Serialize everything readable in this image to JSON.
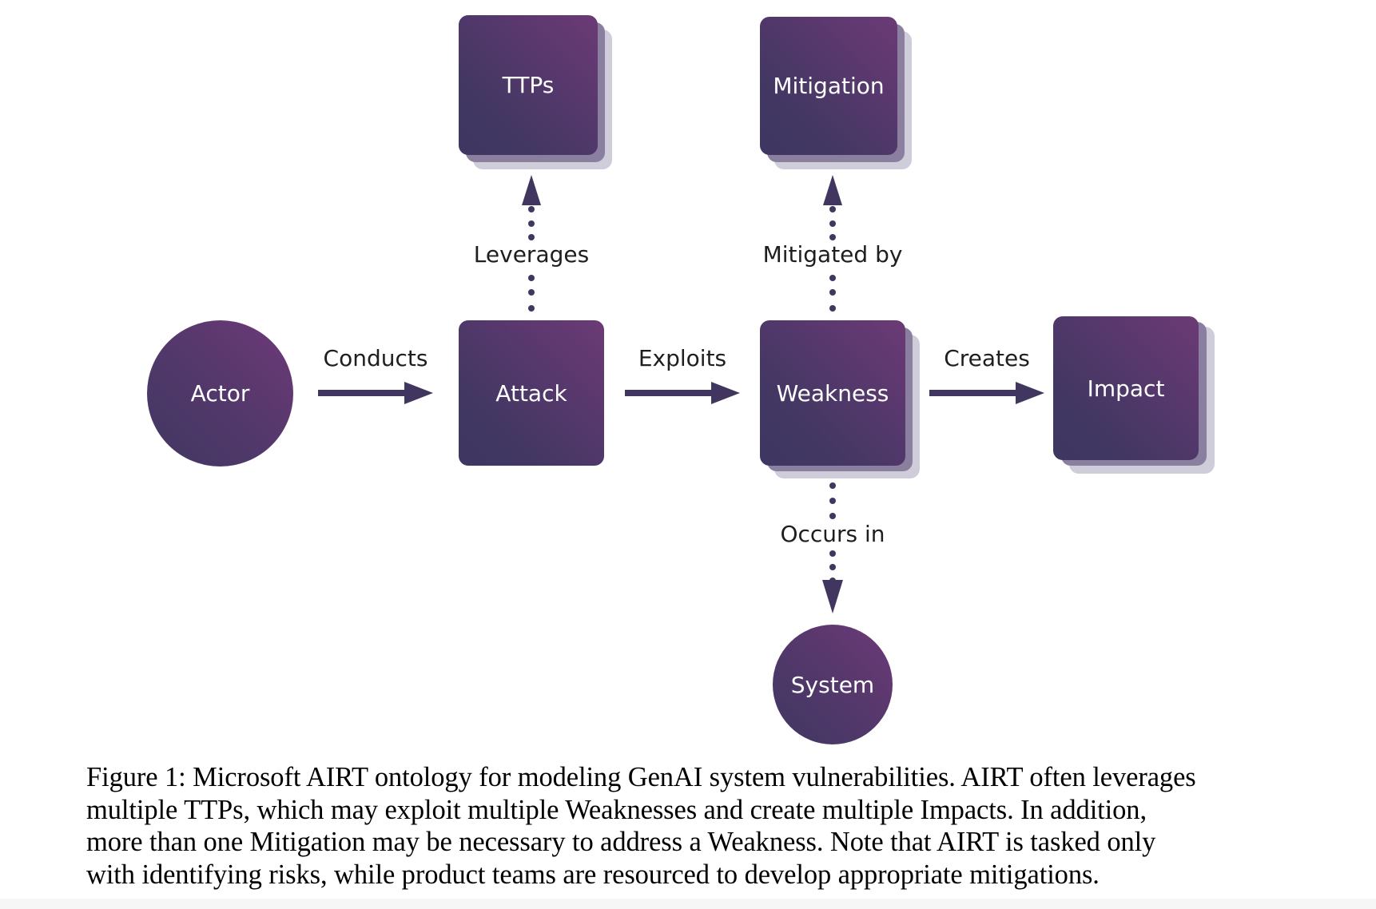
{
  "nodes": {
    "actor": "Actor",
    "attack": "Attack",
    "ttps": "TTPs",
    "weakness": "Weakness",
    "mitigation": "Mitigation",
    "impact": "Impact",
    "system": "System"
  },
  "edges": {
    "conducts": "Conducts",
    "exploits": "Exploits",
    "creates": "Creates",
    "leverages": "Leverages",
    "mitigated_by": "Mitigated by",
    "occurs_in": "Occurs in"
  },
  "colors": {
    "node_dark": "#3e3761",
    "node_light": "#6c3a76",
    "arrow": "#40365f",
    "stack_mid": "#8a7f9e",
    "stack_light": "#d0cddb"
  },
  "caption": {
    "lines": [
      "Figure 1: Microsoft AIRT ontology for modeling GenAI system vulnerabilities. AIRT often leverages",
      "multiple TTPs, which may exploit multiple Weaknesses and create multiple Impacts. In addition,",
      "more than one Mitigation may be necessary to address a Weakness. Note that AIRT is tasked only",
      "with identifying risks, while product teams are resourced to develop appropriate mitigations."
    ]
  }
}
